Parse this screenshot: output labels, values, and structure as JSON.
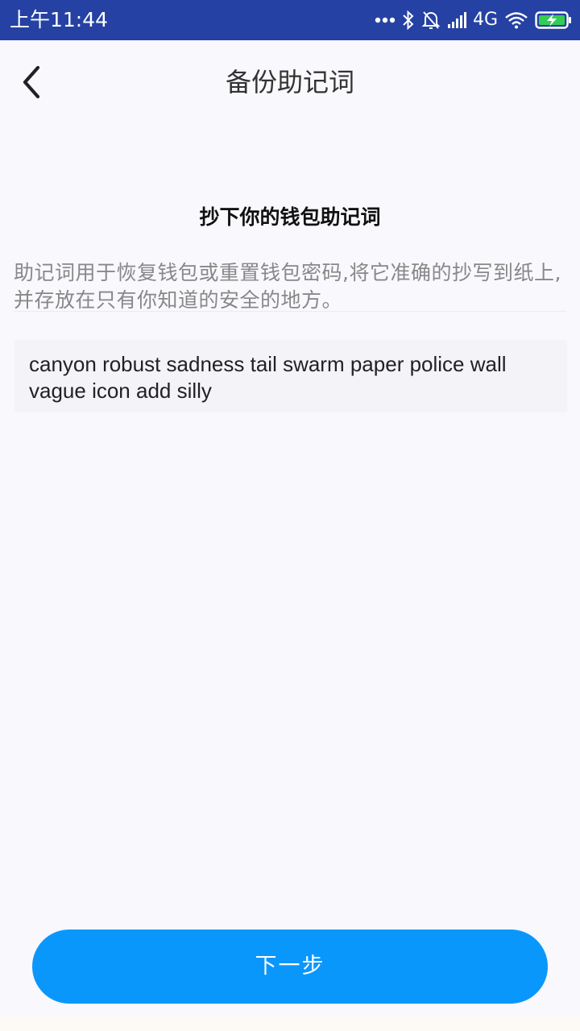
{
  "status_bar": {
    "time": "上午11:44",
    "network": "4G",
    "icons": [
      "more-dots-icon",
      "bluetooth-icon",
      "alarm-off-icon",
      "signal-icon",
      "wifi-icon",
      "battery-charging-icon"
    ],
    "background_color": "#2541a3"
  },
  "header": {
    "title": "备份助记词",
    "back_icon": "chevron-left-icon"
  },
  "content": {
    "heading": "抄下你的钱包助记词",
    "description": "助记词用于恢复钱包或重置钱包密码,将它准确的抄写到纸上,并存放在只有你知道的安全的地方。",
    "mnemonic": "canyon robust sadness tail swarm paper police wall vague icon add silly"
  },
  "footer": {
    "next_label": "下一步",
    "accent_color": "#0a97fb"
  }
}
